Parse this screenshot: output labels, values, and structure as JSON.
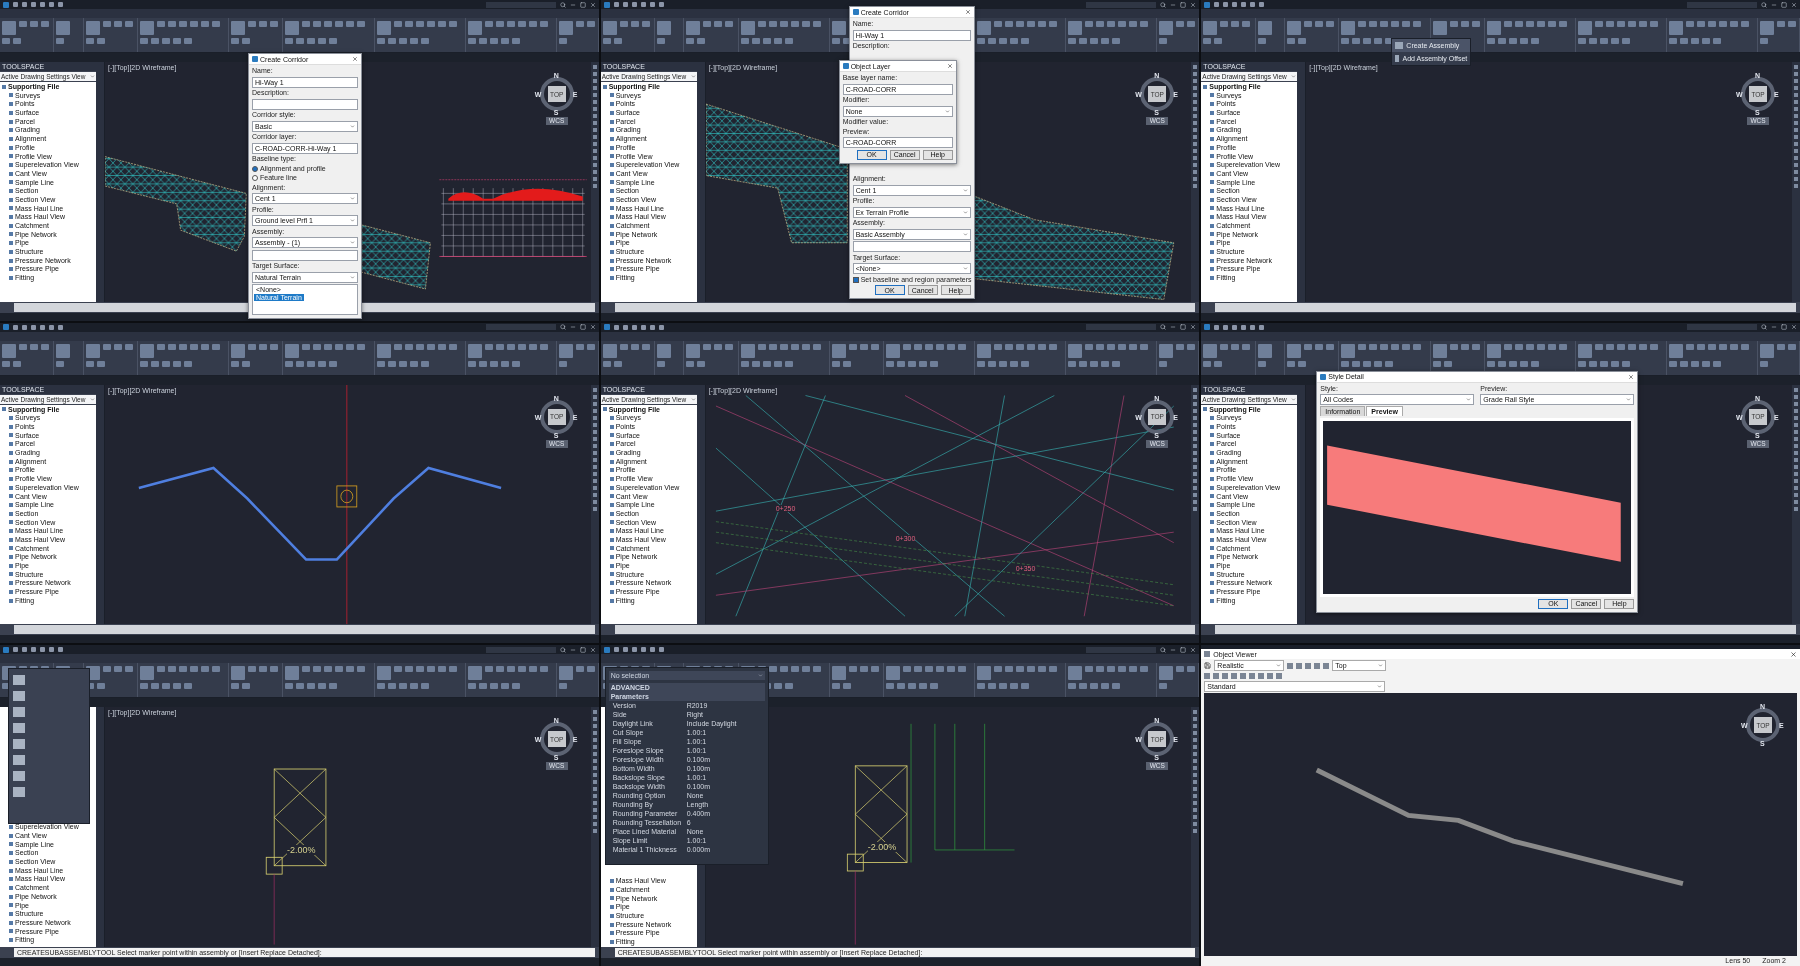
{
  "panels": [
    {
      "kind": "corridor_dialog",
      "toolspace": {
        "title": "TOOLSPACE",
        "view": "Active Drawing Settings View",
        "root": "Supporting File",
        "items": [
          "Surveys",
          "Points",
          "Surface",
          "Parcel",
          "Grading",
          "Alignment",
          "Profile",
          "Profile View",
          "Superelevation View",
          "Cant View",
          "Sample Line",
          "Section",
          "Section View",
          "Mass Haul Line",
          "Mass Haul View",
          "Catchment",
          "Pipe Network",
          "Pipe",
          "Structure",
          "Pressure Network",
          "Pressure Pipe",
          "Fitting"
        ]
      },
      "viewport_label": "[-][Top][2D Wireframe]",
      "compass": {
        "n": "N",
        "e": "E",
        "s": "S",
        "w": "W",
        "top": "TOP",
        "wcs": "WCS"
      },
      "dialog": {
        "title": "Create Corridor",
        "fields": [
          {
            "kind": "text",
            "label": "Name:",
            "value": "Hi-Way 1"
          },
          {
            "kind": "textarea",
            "label": "Description:"
          },
          {
            "kind": "select",
            "label": "Corridor style:",
            "value": "Basic"
          },
          {
            "kind": "text",
            "label": "Corridor layer:",
            "value": "C-ROAD-CORR-Hi-Way 1"
          },
          {
            "kind": "radio",
            "label": "Baseline type:",
            "options": [
              {
                "label": "Alignment and profile",
                "selected": true
              },
              {
                "label": "Feature line",
                "selected": false
              }
            ]
          },
          {
            "kind": "select",
            "label": "Alignment:",
            "value": "Cent 1"
          },
          {
            "kind": "select",
            "label": "Profile:",
            "value": "Ground level Prfl 1"
          },
          {
            "kind": "select",
            "label": "Assembly:",
            "value": "Assembly - (1)"
          },
          {
            "kind": "textarea"
          },
          {
            "kind": "select",
            "label": "Target Surface:",
            "value": "Natural Terrain"
          },
          {
            "kind": "listbox",
            "items": [
              {
                "label": "<None>",
                "selected": false
              },
              {
                "label": "Natural Terrain",
                "selected": true
              }
            ]
          }
        ]
      }
    },
    {
      "kind": "object_layer",
      "toolspace": {
        "title": "TOOLSPACE",
        "view": "Active Drawing Settings View",
        "root": "Supporting File",
        "items": [
          "Surveys",
          "Points",
          "Surface",
          "Parcel",
          "Grading",
          "Alignment",
          "Profile",
          "Profile View",
          "Superelevation View",
          "Cant View",
          "Sample Line",
          "Section",
          "Section View",
          "Mass Haul Line",
          "Mass Haul View",
          "Catchment",
          "Pipe Network",
          "Pipe",
          "Structure",
          "Pressure Network",
          "Pressure Pipe",
          "Fitting"
        ]
      },
      "viewport_label": "[-][Top][2D Wireframe]",
      "compass": {
        "n": "N",
        "e": "E",
        "s": "S",
        "w": "W",
        "top": "TOP",
        "wcs": "WCS"
      },
      "dialog": {
        "title": "Create Corridor",
        "fields": [
          {
            "kind": "text",
            "label": "Name:",
            "value": "Hi-Way 1"
          },
          {
            "kind": "label",
            "label": "Description:"
          },
          {
            "kind": "spacer"
          },
          {
            "kind": "select",
            "label": "Alignment:",
            "value": "Cent 1"
          },
          {
            "kind": "select",
            "label": "Profile:",
            "value": "Ex Terrain Profile"
          },
          {
            "kind": "select",
            "label": "Assembly:",
            "value": "Basic Assembly"
          },
          {
            "kind": "textarea"
          },
          {
            "kind": "select",
            "label": "Target Surface:",
            "value": "<None>"
          },
          {
            "kind": "checkbox",
            "label": "Set baseline and region parameters",
            "checked": true
          },
          {
            "kind": "buttons",
            "labels": [
              "OK",
              "Cancel",
              "Help"
            ]
          }
        ]
      },
      "subdialog": {
        "title": "Object Layer",
        "fields": [
          {
            "kind": "text",
            "label": "Base layer name:",
            "value": "C-ROAD-CORR"
          },
          {
            "kind": "select",
            "label": "Modifier:",
            "value": "None"
          },
          {
            "kind": "label",
            "label": "Modifier value:"
          },
          {
            "kind": "text",
            "label": "Preview:",
            "value": "C-ROAD-CORR"
          },
          {
            "kind": "buttons",
            "labels": [
              "OK",
              "Cancel",
              "Help"
            ]
          }
        ]
      }
    },
    {
      "kind": "assembly_menu",
      "toolspace": {
        "title": "TOOLSPACE",
        "view": "Active Drawing Settings View",
        "root": "Supporting File",
        "items": [
          "Surveys",
          "Points",
          "Surface",
          "Parcel",
          "Grading",
          "Alignment",
          "Profile",
          "Profile View",
          "Superelevation View",
          "Cant View",
          "Sample Line",
          "Section",
          "Section View",
          "Mass Haul Line",
          "Mass Haul View",
          "Catchment",
          "Pipe Network",
          "Pipe",
          "Structure",
          "Pressure Network",
          "Pressure Pipe",
          "Fitting"
        ]
      },
      "viewport_label": "[-][Top][2D Wireframe]",
      "compass": {
        "n": "N",
        "e": "E",
        "s": "S",
        "w": "W",
        "top": "TOP",
        "wcs": "WCS"
      },
      "menu": [
        {
          "label": "Create Assembly",
          "selected": true
        },
        {
          "label": "Add Assembly Offset",
          "selected": false
        }
      ]
    },
    {
      "kind": "assembly_view",
      "toolspace": {
        "title": "TOOLSPACE",
        "view": "Active Drawing Settings View",
        "root": "Supporting File",
        "items": [
          "Surveys",
          "Points",
          "Surface",
          "Parcel",
          "Grading",
          "Alignment",
          "Profile",
          "Profile View",
          "Superelevation View",
          "Cant View",
          "Sample Line",
          "Section",
          "Section View",
          "Mass Haul Line",
          "Mass Haul View",
          "Catchment",
          "Pipe Network",
          "Pipe",
          "Structure",
          "Pressure Network",
          "Pressure Pipe",
          "Fitting"
        ]
      },
      "viewport_label": "[-][Top][2D Wireframe]",
      "compass": {
        "n": "N",
        "e": "E",
        "s": "S",
        "w": "W",
        "top": "TOP",
        "wcs": "WCS"
      }
    },
    {
      "kind": "triangles",
      "toolspace": {
        "title": "TOOLSPACE",
        "view": "Active Drawing Settings View",
        "root": "Supporting File",
        "items": [
          "Surveys",
          "Points",
          "Surface",
          "Parcel",
          "Grading",
          "Alignment",
          "Profile",
          "Profile View",
          "Superelevation View",
          "Cant View",
          "Sample Line",
          "Section",
          "Section View",
          "Mass Haul Line",
          "Mass Haul View",
          "Catchment",
          "Pipe Network",
          "Pipe",
          "Structure",
          "Pressure Network",
          "Pressure Pipe",
          "Fitting"
        ]
      },
      "viewport_label": "[-][Top][2D Wireframe]",
      "compass": {
        "n": "N",
        "e": "E",
        "s": "S",
        "w": "W",
        "top": "TOP",
        "wcs": "WCS"
      },
      "labels": [
        "0+250",
        "0+300",
        "0+350"
      ]
    },
    {
      "kind": "style_detail",
      "toolspace": {
        "title": "TOOLSPACE",
        "view": "Active Drawing Settings View",
        "root": "Supporting File",
        "items": [
          "Surveys",
          "Points",
          "Surface",
          "Parcel",
          "Grading",
          "Alignment",
          "Profile",
          "Profile View",
          "Superelevation View",
          "Cant View",
          "Sample Line",
          "Section",
          "Section View",
          "Mass Haul Line",
          "Mass Haul View",
          "Catchment",
          "Pipe Network",
          "Pipe",
          "Structure",
          "Pressure Network",
          "Pressure Pipe",
          "Fitting"
        ]
      },
      "compass": {
        "n": "N",
        "e": "E",
        "s": "S",
        "w": "W",
        "top": "TOP",
        "wcs": "WCS"
      },
      "style_dialog": {
        "title": "Style Detail",
        "style_label": "Style:",
        "style_value": "All Codes",
        "preview_label": "Preview:",
        "preview_value": "Grade Rail Style",
        "tabs": [
          {
            "label": "Information",
            "selected": false
          },
          {
            "label": "Preview",
            "selected": true
          }
        ],
        "buttons": [
          "OK",
          "Cancel",
          "Help"
        ]
      }
    },
    {
      "kind": "subassembly_palette",
      "toolspace": {
        "items": [
          "Superelevation View",
          "Cant View",
          "Sample Line",
          "Section",
          "Section View",
          "Mass Haul Line",
          "Mass Haul View",
          "Catchment",
          "Pipe Network",
          "Pipe",
          "Structure",
          "Pressure Network",
          "Pressure Pipe",
          "Fitting"
        ]
      },
      "viewport_label": "[-][Top][2D Wireframe]",
      "compass": {
        "n": "N",
        "e": "E",
        "s": "S",
        "w": "W",
        "top": "TOP",
        "wcs": "WCS"
      },
      "command": "CREATESUBASSEMBLYTOOL Select marker point within assembly or [Insert Replace Detached]:",
      "grade": "-2.00%"
    },
    {
      "kind": "subassembly_properties",
      "toolspace": {
        "items": [
          "Mass Haul View",
          "Catchment",
          "Pipe Network",
          "Pipe",
          "Structure",
          "Pressure Network",
          "Pressure Pipe",
          "Fitting"
        ]
      },
      "compass": {
        "n": "N",
        "e": "E",
        "s": "S",
        "w": "W",
        "top": "TOP",
        "wcs": "WCS"
      },
      "command": "CREATESUBASSEMBLYTOOL Select marker point within assembly or [Insert Replace Detached]:",
      "grade": "-2.00%",
      "properties": {
        "selector": "No selection",
        "sections": [
          {
            "title": "ADVANCED"
          },
          {
            "title": "Parameters",
            "rows": [
              {
                "name": "Version",
                "value": "R2019"
              },
              {
                "name": "Side",
                "value": "Right"
              },
              {
                "name": "Daylight Link",
                "value": "Include Daylight"
              },
              {
                "name": "Cut Slope",
                "value": "1.00:1"
              },
              {
                "name": "Fill Slope",
                "value": "1.00:1"
              },
              {
                "name": "Foreslope Slope",
                "value": "1.00:1"
              },
              {
                "name": "Foreslope Width",
                "value": "0.100m"
              },
              {
                "name": "Bottom Width",
                "value": "0.100m"
              },
              {
                "name": "Backslope Slope",
                "value": "1.00:1"
              },
              {
                "name": "Backslope Width",
                "value": "0.100m"
              },
              {
                "name": "Rounding Option",
                "value": "None"
              },
              {
                "name": "Rounding By",
                "value": "Length"
              },
              {
                "name": "Rounding Parameter",
                "value": "0.400m"
              },
              {
                "name": "Rounding Tessellation",
                "value": "6"
              },
              {
                "name": "Place Lined Material",
                "value": "None"
              },
              {
                "name": "Slope Limit",
                "value": "1.00:1"
              },
              {
                "name": "Material 1 Thickness",
                "value": "0.000m"
              }
            ]
          }
        ]
      }
    },
    {
      "kind": "object_viewer",
      "window_title": "Object Viewer",
      "visual_style": "Realistic",
      "view": "Top",
      "style": "Standard",
      "compass": {
        "n": "N",
        "e": "E",
        "s": "S",
        "w": "W",
        "top": "TOP"
      },
      "status": [
        "Lens 50",
        "Zoom 2"
      ]
    }
  ]
}
